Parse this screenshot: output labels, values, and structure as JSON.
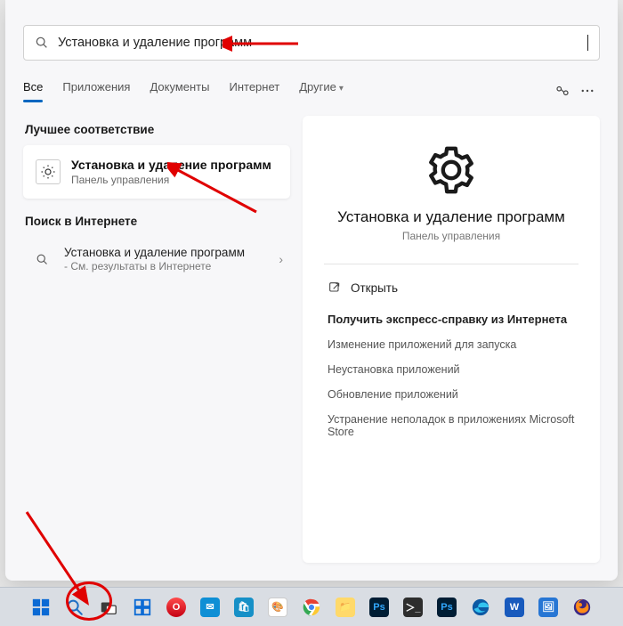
{
  "search": {
    "value": "Установка и удаление программ"
  },
  "tabs": {
    "all": "Все",
    "apps": "Приложения",
    "docs": "Документы",
    "web": "Интернет",
    "more": "Другие"
  },
  "left": {
    "best_match": "Лучшее соответствие",
    "result": {
      "title": "Установка и удаление программ",
      "subtitle": "Панель управления"
    },
    "search_web_h": "Поиск в Интернете",
    "web_result": {
      "title": "Установка и удаление программ",
      "subtitle": "- См. результаты в Интернете"
    }
  },
  "detail": {
    "title": "Установка и удаление программ",
    "subtitle": "Панель управления",
    "open": "Открыть",
    "help_h": "Получить экспресс-справку из Интернета",
    "links": [
      "Изменение приложений для запуска",
      "Неустановка приложений",
      "Обновление приложений",
      "Устранение неполадок в приложениях Microsoft Store"
    ]
  }
}
